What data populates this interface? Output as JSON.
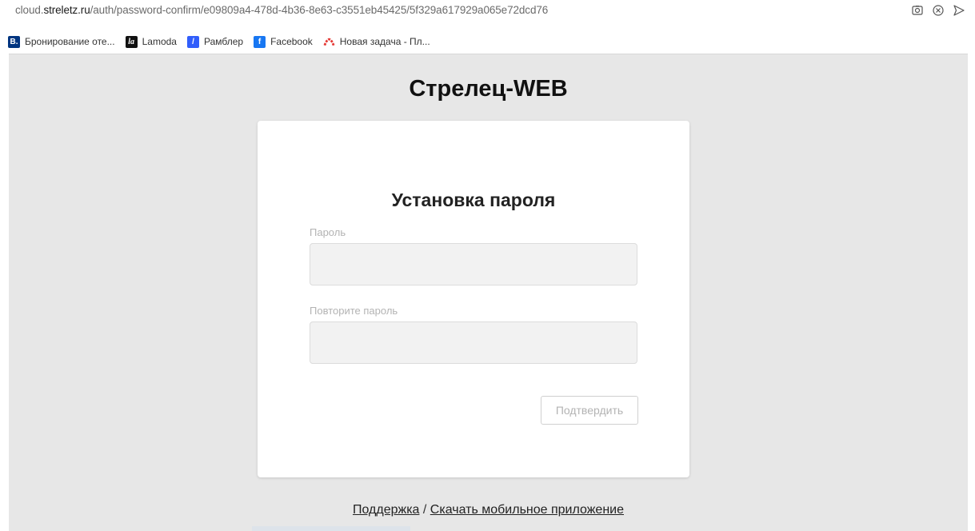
{
  "browser": {
    "url_prefix": "cloud.",
    "url_domain": "streletz.ru",
    "url_path": "/auth/password-confirm/e09809a4-478d-4b36-8e63-c3551eb45425/5f329a617929a065e72dcd76",
    "icons": [
      "screenshot-icon",
      "close-circle-icon",
      "send-icon"
    ]
  },
  "bookmarks": [
    {
      "label": "Бронирование оте...",
      "icon_text": "B.",
      "color": "#003580"
    },
    {
      "label": "Lamoda",
      "icon_text": "la",
      "color": "#111111"
    },
    {
      "label": "Рамблер",
      "icon_text": "/",
      "color": "#315efb"
    },
    {
      "label": "Facebook",
      "icon_text": "f",
      "color": "#1877f2"
    },
    {
      "label": "Новая задача - Пл...",
      "icon_text": "",
      "color": "#e53935"
    }
  ],
  "app": {
    "brand": "Стрелец-WEB"
  },
  "form": {
    "title": "Установка пароля",
    "password_label": "Пароль",
    "password_value": "",
    "confirm_label": "Повторите пароль",
    "confirm_value": "",
    "submit_label": "Подтвердить"
  },
  "footer": {
    "support_link": "Поддержка",
    "separator": " / ",
    "download_link": "Скачать мобильное приложение"
  }
}
